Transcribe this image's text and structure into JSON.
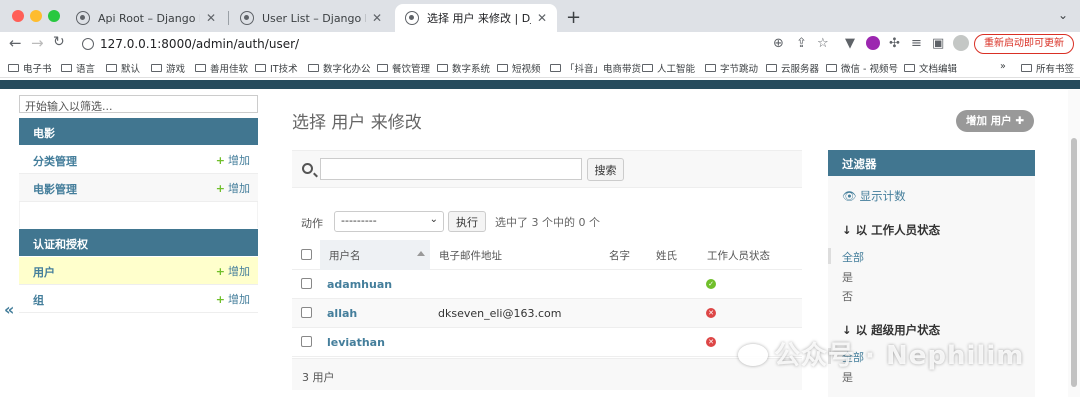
{
  "browser": {
    "tabs": [
      {
        "title": "Api Root – Django REST frame"
      },
      {
        "title": "User List – Django REST frame"
      },
      {
        "title": "选择 用户 来修改 | Django 站点管"
      }
    ],
    "url": "127.0.0.1:8000/admin/auth/user/",
    "restart_button": "重新启动即可更新",
    "bookmarks": [
      "电子书",
      "语言",
      "默认",
      "游戏",
      "善用佳软",
      "IT技术",
      "数字化办公",
      "餐饮管理",
      "数字系统",
      "短视频",
      "「抖音」电商带货",
      "人工智能",
      "字节跳动",
      "云服务器",
      "微信 - 视频号",
      "文档编辑"
    ],
    "more_bookmarks": "»",
    "all_bookmarks": "所有书签"
  },
  "sidebar": {
    "filter_placeholder": "开始输入以筛选...",
    "modules": [
      {
        "name": "电影",
        "models": [
          {
            "label": "分类管理",
            "add": "增加"
          },
          {
            "label": "电影管理",
            "add": "增加"
          }
        ]
      },
      {
        "name": "认证和授权",
        "models": [
          {
            "label": "用户",
            "add": "增加"
          },
          {
            "label": "组",
            "add": "增加"
          }
        ]
      }
    ],
    "collapse_icon": "«"
  },
  "main": {
    "title": "选择 用户 来修改",
    "add_button": "增加 用户",
    "search_button": "搜索",
    "search_value": "",
    "action_label": "动作",
    "action_selected": "---------",
    "run_button": "执行",
    "selection_counter": "选中了 3 个中的 0 个",
    "columns": [
      "用户名",
      "电子邮件地址",
      "名字",
      "姓氏",
      "工作人员状态"
    ],
    "rows": [
      {
        "username": "adamhuan",
        "email": "",
        "first_name": "",
        "last_name": "",
        "is_staff": true
      },
      {
        "username": "allah",
        "email": "dkseven_eli@163.com",
        "first_name": "",
        "last_name": "",
        "is_staff": false
      },
      {
        "username": "leviathan",
        "email": "",
        "first_name": "",
        "last_name": "",
        "is_staff": false
      }
    ],
    "result_count": "3 用户"
  },
  "filter": {
    "header": "过滤器",
    "show_counts": "显示计数",
    "groups": [
      {
        "title": "以 工作人员状态",
        "options": [
          "全部",
          "是",
          "否"
        ]
      },
      {
        "title": "以 超级用户状态",
        "options": [
          "全部",
          "是"
        ]
      }
    ]
  },
  "watermark": "公众号 · Nephilim",
  "colors": {
    "module_header": "#417690",
    "django_bar": "#264b5d",
    "link": "#447e9b",
    "add_green": "#70bf2b",
    "yes": "#70bf2b",
    "no": "#dd4646",
    "current_row": "#ffffcc"
  }
}
